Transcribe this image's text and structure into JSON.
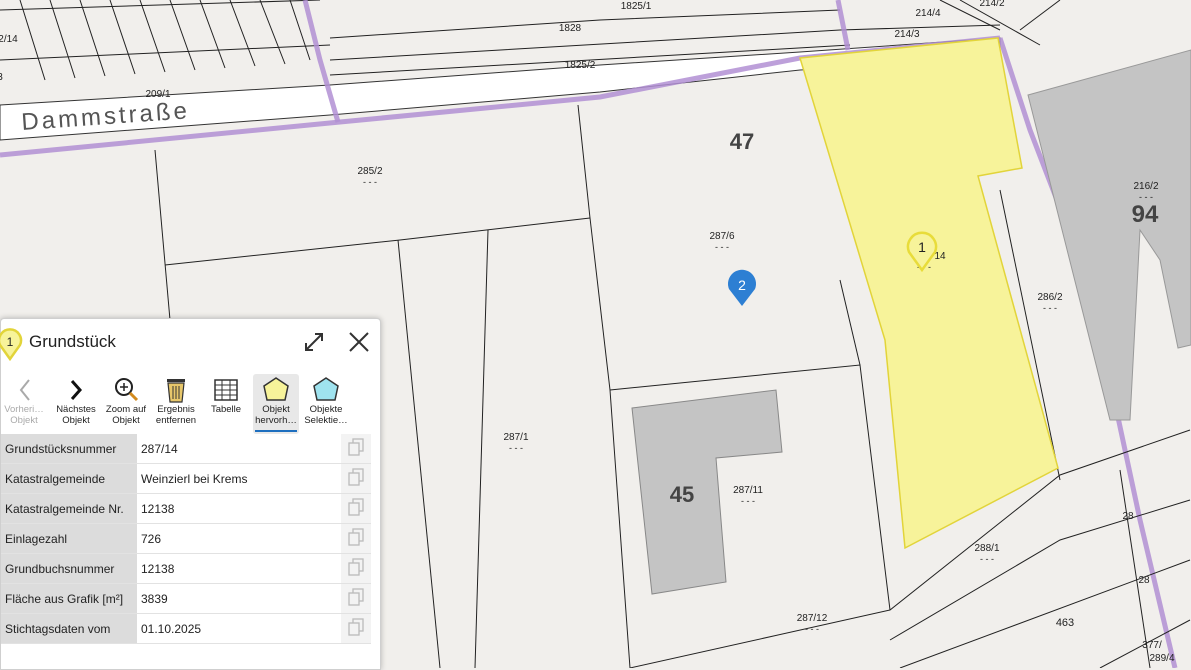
{
  "map": {
    "street_name": "Dammstraße",
    "parcels": [
      "1825/1",
      "1828",
      "1825/2",
      "214/4",
      "214/2",
      "214/3",
      "2/14",
      "3",
      "209/1",
      "285/2",
      "287/6",
      "216/2",
      "286/2",
      "287/1",
      "287/11",
      "288/1",
      "287/12",
      "463",
      "377/",
      "289/4",
      "28",
      "28"
    ],
    "house_numbers": [
      "47",
      "94",
      "45"
    ],
    "highlighted_parcel_fragment": "14",
    "parcel_sublabel": "- - -",
    "markers": [
      {
        "label": "1",
        "color": "#f3ea6b"
      },
      {
        "label": "2",
        "color": "#2d7fd3"
      }
    ],
    "colors": {
      "highlight_fill": "#f7f39a",
      "highlight_stroke": "#e2d43a",
      "boundary": "#b18fd4",
      "building": "#c4c4c4"
    }
  },
  "panel": {
    "marker_label": "1",
    "title": "Grundstück",
    "toolbar": [
      {
        "line1": "Vorheri…",
        "line2": "Objekt",
        "icon": "chevron-left-icon",
        "disabled": true
      },
      {
        "line1": "Nächstes",
        "line2": "Objekt",
        "icon": "chevron-right-icon",
        "disabled": false
      },
      {
        "line1": "Zoom auf",
        "line2": "Objekt",
        "icon": "zoom-in-icon",
        "disabled": false
      },
      {
        "line1": "Ergebnis",
        "line2": "entfernen",
        "icon": "trash-icon",
        "disabled": false
      },
      {
        "line1": "Tabelle",
        "line2": "",
        "icon": "table-icon",
        "disabled": false
      },
      {
        "line1": "Objekt",
        "line2": "hervorh…",
        "icon": "highlight-polygon-icon",
        "disabled": false
      },
      {
        "line1": "Objekte",
        "line2": "Selektie…",
        "icon": "select-polygon-icon",
        "disabled": false
      }
    ],
    "attributes": [
      {
        "key": "Grundstücksnummer",
        "value": "287/14"
      },
      {
        "key": "Katastralgemeinde",
        "value": "Weinzierl bei Krems"
      },
      {
        "key": "Katastralgemeinde Nr.",
        "value": "12138"
      },
      {
        "key": "Einlagezahl",
        "value": "726"
      },
      {
        "key": "Grundbuchsnummer",
        "value": "12138"
      },
      {
        "key": "Fläche aus Grafik [m²]",
        "value": "3839"
      },
      {
        "key": "Stichtagsdaten vom",
        "value": "01.10.2025"
      }
    ]
  }
}
